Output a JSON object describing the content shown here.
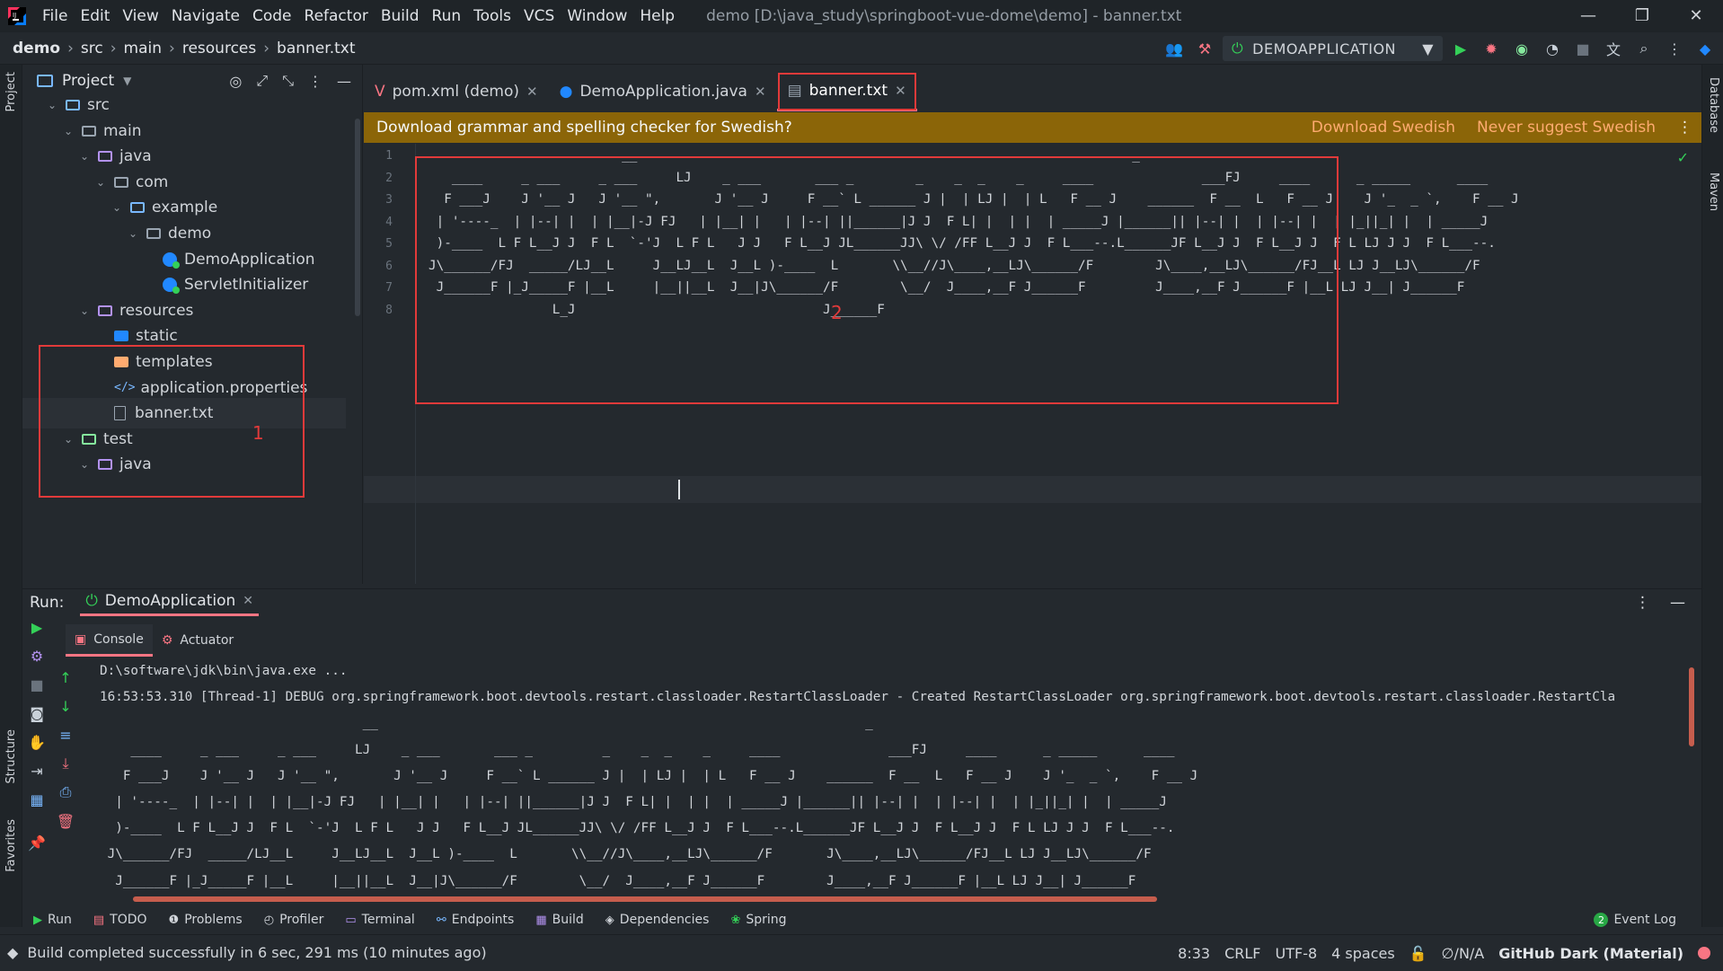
{
  "menu": [
    "File",
    "Edit",
    "View",
    "Navigate",
    "Code",
    "Refactor",
    "Build",
    "Run",
    "Tools",
    "VCS",
    "Window",
    "Help"
  ],
  "window_title": "demo [D:\\java_study\\springboot-vue-dome\\demo] - banner.txt",
  "breadcrumb": [
    "demo",
    "src",
    "main",
    "resources",
    "banner.txt"
  ],
  "run_config": "DEMOAPPLICATION",
  "project_panel": {
    "title": "Project"
  },
  "tree": [
    {
      "label": "src",
      "depth": 1,
      "kind": "src",
      "open": true
    },
    {
      "label": "main",
      "depth": 2,
      "kind": "plain",
      "open": true
    },
    {
      "label": "java",
      "depth": 3,
      "kind": "java",
      "open": true
    },
    {
      "label": "com",
      "depth": 4,
      "kind": "plain",
      "open": true
    },
    {
      "label": "example",
      "depth": 5,
      "kind": "pkg",
      "open": true
    },
    {
      "label": "demo",
      "depth": 6,
      "kind": "plain",
      "open": true
    },
    {
      "label": "DemoApplication",
      "depth": 7,
      "kind": "class"
    },
    {
      "label": "ServletInitializer",
      "depth": 7,
      "kind": "class"
    },
    {
      "label": "resources",
      "depth": 3,
      "kind": "res",
      "open": true
    },
    {
      "label": "static",
      "depth": 4,
      "kind": "blue"
    },
    {
      "label": "templates",
      "depth": 4,
      "kind": "yellow"
    },
    {
      "label": "application.properties",
      "depth": 4,
      "kind": "prop"
    },
    {
      "label": "banner.txt",
      "depth": 4,
      "kind": "txt",
      "selected": true
    },
    {
      "label": "test",
      "depth": 2,
      "kind": "test",
      "open": true
    },
    {
      "label": "java",
      "depth": 3,
      "kind": "java",
      "open": true
    }
  ],
  "tabs": [
    {
      "label": "pom.xml (demo)",
      "icon": "maven-icon"
    },
    {
      "label": "DemoApplication.java",
      "icon": "class-icon"
    },
    {
      "label": "banner.txt",
      "icon": "text-file-icon",
      "active": true
    }
  ],
  "notification": {
    "text": "Download grammar and spelling checker for Swedish?",
    "action1": "Download Swedish",
    "action2": "Never suggest Swedish"
  },
  "editor": {
    "line_numbers": [
      "1",
      "2",
      "3",
      "4",
      "5",
      "6",
      "7",
      "8"
    ],
    "lines": [
      "                         __                                                                _",
      "   ____     _ ___     _ ___     LJ    _ ___       ___ _        _    _  _    _     ____              ___FJ     ____      _ _____      ____",
      "  F ___J    J '__ J   J '__ \",       J '__ J     F __` L ______ J |  | LJ |  | L   F __ J    ______  F __  L   F __ J    J '_  _ `,    F __ J",
      " | '----_  | |--| |  | |__|-J FJ   | |__| |   | |--| ||______|J J  F L| |  | |  | _____J |______|| |--| |  | |--| |  | |_||_| |  | _____J",
      " )-____  L F L__J J  F L  `-'J  L F L   J J   F L__J JL______JJ\\ \\/ /FF L__J J  F L___--.L______JF L__J J  F L__J J  F L LJ J J  F L___--.",
      "J\\______/FJ  _____/LJ__L     J__LJ__L  J__L )-____  L       \\\\__//J\\____,__LJ\\______/F        J\\____,__LJ\\______/FJ__L LJ J__LJ\\______/F",
      " J______F |_J_____F |__L     |__||__L  J__|J\\______/F        \\__/  J____,__F J______F         J____,__F J______F |__L LJ J__| J______F",
      "                L_J                                J______F"
    ]
  },
  "annotations": {
    "box1": "1",
    "box2": "2"
  },
  "run_panel": {
    "label": "Run:",
    "tab": "DemoApplication",
    "subtabs": [
      "Console",
      "Actuator"
    ]
  },
  "console": {
    "lines": [
      "D:\\software\\jdk\\bin\\java.exe ...",
      "16:53:53.310 [Thread-1] DEBUG org.springframework.boot.devtools.restart.classloader.RestartClassLoader - Created RestartClassLoader org.springframework.boot.devtools.restart.classloader.RestartCla",
      "                                  __                                                               _",
      "    ____     _ ___     _ ___     LJ    _ ___       ___ _         _    _  _    _     ____              ___FJ     ____      _ _____      ____",
      "   F ___J    J '__ J   J '__ \",       J '__ J     F __` L ______ J |  | LJ |  | L   F __ J    ______  F __  L   F __ J    J '_  _ `,    F __ J",
      "  | '----_  | |--| |  | |__|-J FJ   | |__| |   | |--| ||______|J J  F L| |  | |  | _____J |______|| |--| |  | |--| |  | |_||_| |  | _____J",
      "  )-____  L F L__J J  F L  `-'J  L F L   J J   F L__J JL______JJ\\ \\/ /FF L__J J  F L___--.L______JF L__J J  F L__J J  F L LJ J J  F L___--.",
      " J\\______/FJ  _____/LJ__L     J__LJ__L  J__L )-____  L       \\\\__//J\\____,__LJ\\______/F       J\\____,__LJ\\______/FJ__L LJ J__LJ\\______/F",
      "  J______F |_J_____F |__L     |__||__L  J__|J\\______/F        \\__/  J____,__F J______F        J____,__F J______F |__L LJ J__| J______F"
    ]
  },
  "bottom_tabs": [
    {
      "label": "Run",
      "icon": "run-icon"
    },
    {
      "label": "TODO",
      "icon": "todo-icon"
    },
    {
      "label": "Problems",
      "icon": "problems-icon"
    },
    {
      "label": "Profiler",
      "icon": "profiler-icon"
    },
    {
      "label": "Terminal",
      "icon": "terminal-icon"
    },
    {
      "label": "Endpoints",
      "icon": "endpoints-icon"
    },
    {
      "label": "Build",
      "icon": "build-icon"
    },
    {
      "label": "Dependencies",
      "icon": "dependencies-icon"
    },
    {
      "label": "Spring",
      "icon": "spring-icon"
    }
  ],
  "event_log": {
    "badge": "2",
    "label": "Event Log"
  },
  "status": {
    "message": "Build completed successfully in 6 sec, 291 ms (10 minutes ago)",
    "position": "8:33",
    "line_sep": "CRLF",
    "encoding": "UTF-8",
    "indent": "4 spaces",
    "vcs": "∅/N/A",
    "theme": "GitHub Dark (Material)"
  },
  "side_labels": {
    "project": "Project",
    "structure": "Structure",
    "favorites": "Favorites",
    "database": "Database",
    "maven": "Maven"
  },
  "colors": {
    "accent": "#f97583",
    "annotation": "#e23a3a",
    "banner": "#8b6508",
    "banner_action": "#ffab70"
  }
}
